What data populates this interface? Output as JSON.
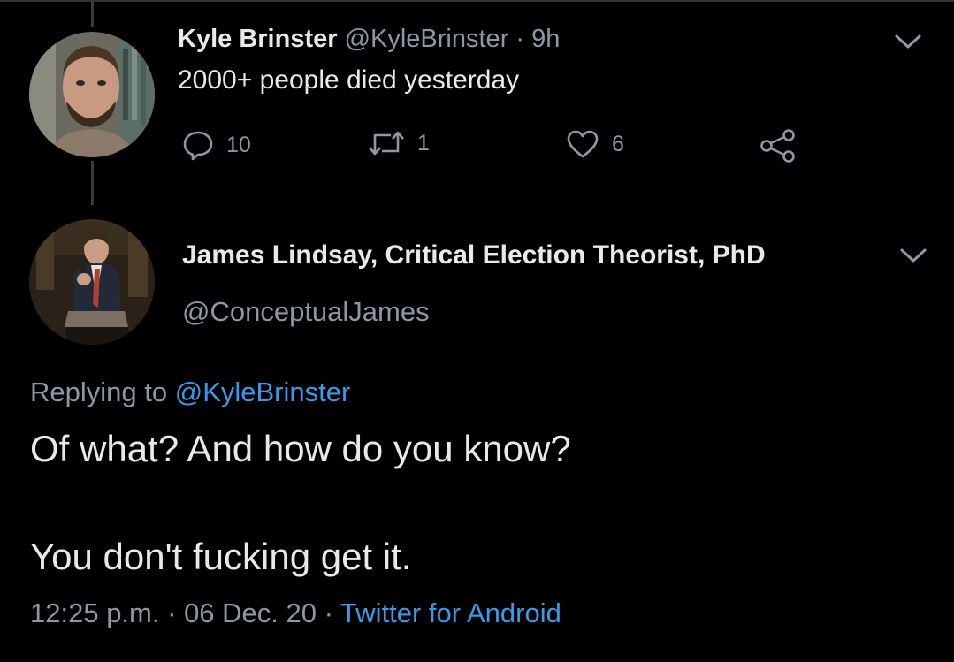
{
  "parent_tweet": {
    "author_name": "Kyle Brinster",
    "author_handle": "@KyleBrinster",
    "separator": "·",
    "time": "9h",
    "text": "2000+ people died yesterday",
    "counts": {
      "replies": "10",
      "retweets": "1",
      "likes": "6"
    }
  },
  "main_tweet": {
    "author_name": "James Lindsay, Critical Election Theorist, PhD",
    "author_handle": "@ConceptualJames",
    "replying_prefix": "Replying to",
    "replying_handle": "@KyleBrinster",
    "line1": "Of what? And how do you know?",
    "line2": "You don't fucking get it.",
    "time": "12:25 p.m.",
    "sep1": "·",
    "date": "06 Dec. 20",
    "sep2": "·",
    "client": "Twitter for Android"
  },
  "colors": {
    "background": "#000000",
    "link": "#3b9ae8",
    "muted": "#8b98a5",
    "text": "#e7e9ea"
  },
  "icons": [
    "chevron-down-icon",
    "reply-icon",
    "retweet-icon",
    "like-icon",
    "share-icon"
  ]
}
